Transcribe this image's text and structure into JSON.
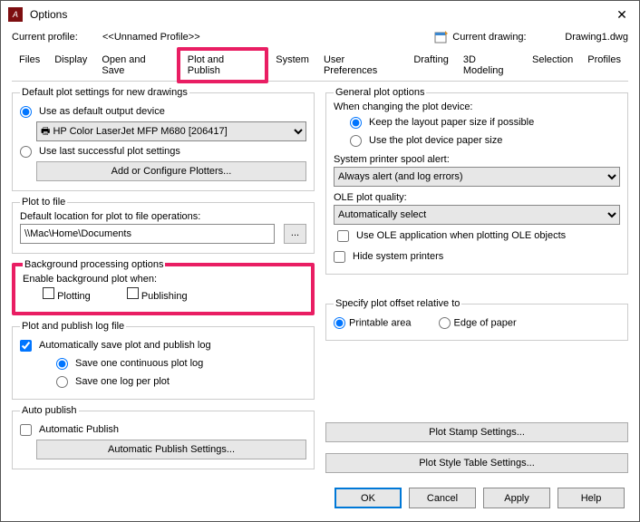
{
  "window": {
    "title": "Options"
  },
  "header": {
    "profile_label": "Current profile:",
    "profile_value": "<<Unnamed Profile>>",
    "drawing_label": "Current drawing:",
    "drawing_value": "Drawing1.dwg"
  },
  "tabs": [
    "Files",
    "Display",
    "Open and Save",
    "Plot and Publish",
    "System",
    "User Preferences",
    "Drafting",
    "3D Modeling",
    "Selection",
    "Profiles"
  ],
  "active_tab": "Plot and Publish",
  "left": {
    "default_plot_group": "Default plot settings for new drawings",
    "use_default_device": "Use as default output device",
    "device_name": "HP Color LaserJet MFP M680 [206417]",
    "use_last_settings": "Use last successful plot settings",
    "add_plotters_btn": "Add or Configure Plotters...",
    "plot_to_file_group": "Plot to file",
    "plot_to_file_label": "Default location for plot to file operations:",
    "plot_to_file_path": "\\\\Mac\\Home\\Documents",
    "bg_group": "Background processing options",
    "bg_label": "Enable background plot when:",
    "bg_plotting": "Plotting",
    "bg_publishing": "Publishing",
    "log_group": "Plot and publish log file",
    "log_auto_save": "Automatically save plot and publish log",
    "log_one_continuous": "Save one continuous plot log",
    "log_one_per_plot": "Save one log per plot",
    "auto_pub_group": "Auto publish",
    "auto_pub_check": "Automatic Publish",
    "auto_pub_btn": "Automatic Publish Settings..."
  },
  "right": {
    "general_group": "General plot options",
    "change_device_label": "When changing the plot device:",
    "keep_layout": "Keep the layout paper size if possible",
    "use_device_paper": "Use the plot device paper size",
    "spool_label": "System printer spool alert:",
    "spool_value": "Always alert (and log errors)",
    "ole_label": "OLE plot quality:",
    "ole_value": "Automatically select",
    "ole_app": "Use OLE application when plotting OLE objects",
    "hide_printers": "Hide system printers",
    "offset_group": "Specify plot offset relative to",
    "offset_printable": "Printable area",
    "offset_edge": "Edge of paper",
    "stamp_btn": "Plot Stamp Settings...",
    "style_btn": "Plot Style Table Settings..."
  },
  "footer": {
    "ok": "OK",
    "cancel": "Cancel",
    "apply": "Apply",
    "help": "Help"
  }
}
